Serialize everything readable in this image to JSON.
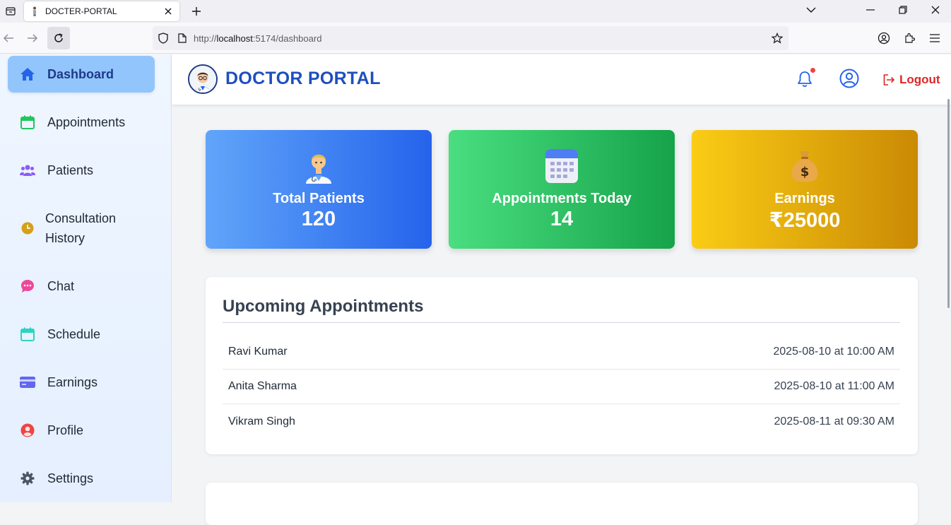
{
  "browser": {
    "tab_title": "DOCTER-PORTAL",
    "url_prefix": "http://",
    "url_host": "localhost",
    "url_rest": ":5174/dashboard"
  },
  "sidebar": {
    "items": [
      {
        "label": "Dashboard",
        "icon": "home-icon",
        "active": true
      },
      {
        "label": "Appointments",
        "icon": "calendar-icon"
      },
      {
        "label": "Patients",
        "icon": "users-icon"
      },
      {
        "label": "Consultation History",
        "icon": "clock-icon"
      },
      {
        "label": "Chat",
        "icon": "chat-icon"
      },
      {
        "label": "Schedule",
        "icon": "calendar-icon"
      },
      {
        "label": "Earnings",
        "icon": "credit-card-icon"
      },
      {
        "label": "Profile",
        "icon": "user-circle-icon"
      },
      {
        "label": "Settings",
        "icon": "gear-icon"
      }
    ]
  },
  "header": {
    "brand": "DOCTOR PORTAL",
    "logout_label": "Logout"
  },
  "stats": [
    {
      "label": "Total Patients",
      "value": "120",
      "icon": "health-worker-emoji"
    },
    {
      "label": "Appointments Today",
      "value": "14",
      "icon": "calendar-emoji"
    },
    {
      "label": "Earnings",
      "value": "₹25000",
      "icon": "money-bag-emoji"
    }
  ],
  "upcoming": {
    "title": "Upcoming Appointments",
    "rows": [
      {
        "name": "Ravi Kumar",
        "when": "2025-08-10 at 10:00 AM"
      },
      {
        "name": "Anita Sharma",
        "when": "2025-08-10 at 11:00 AM"
      },
      {
        "name": "Vikram Singh",
        "when": "2025-08-11 at 09:30 AM"
      }
    ]
  },
  "colors": {
    "brand": "#1e4fbf",
    "active_nav": "#93c5fd",
    "logout": "#dc2626",
    "card_blue": "#2563eb",
    "card_green": "#16a34a",
    "card_gold": "#ca8a04"
  }
}
